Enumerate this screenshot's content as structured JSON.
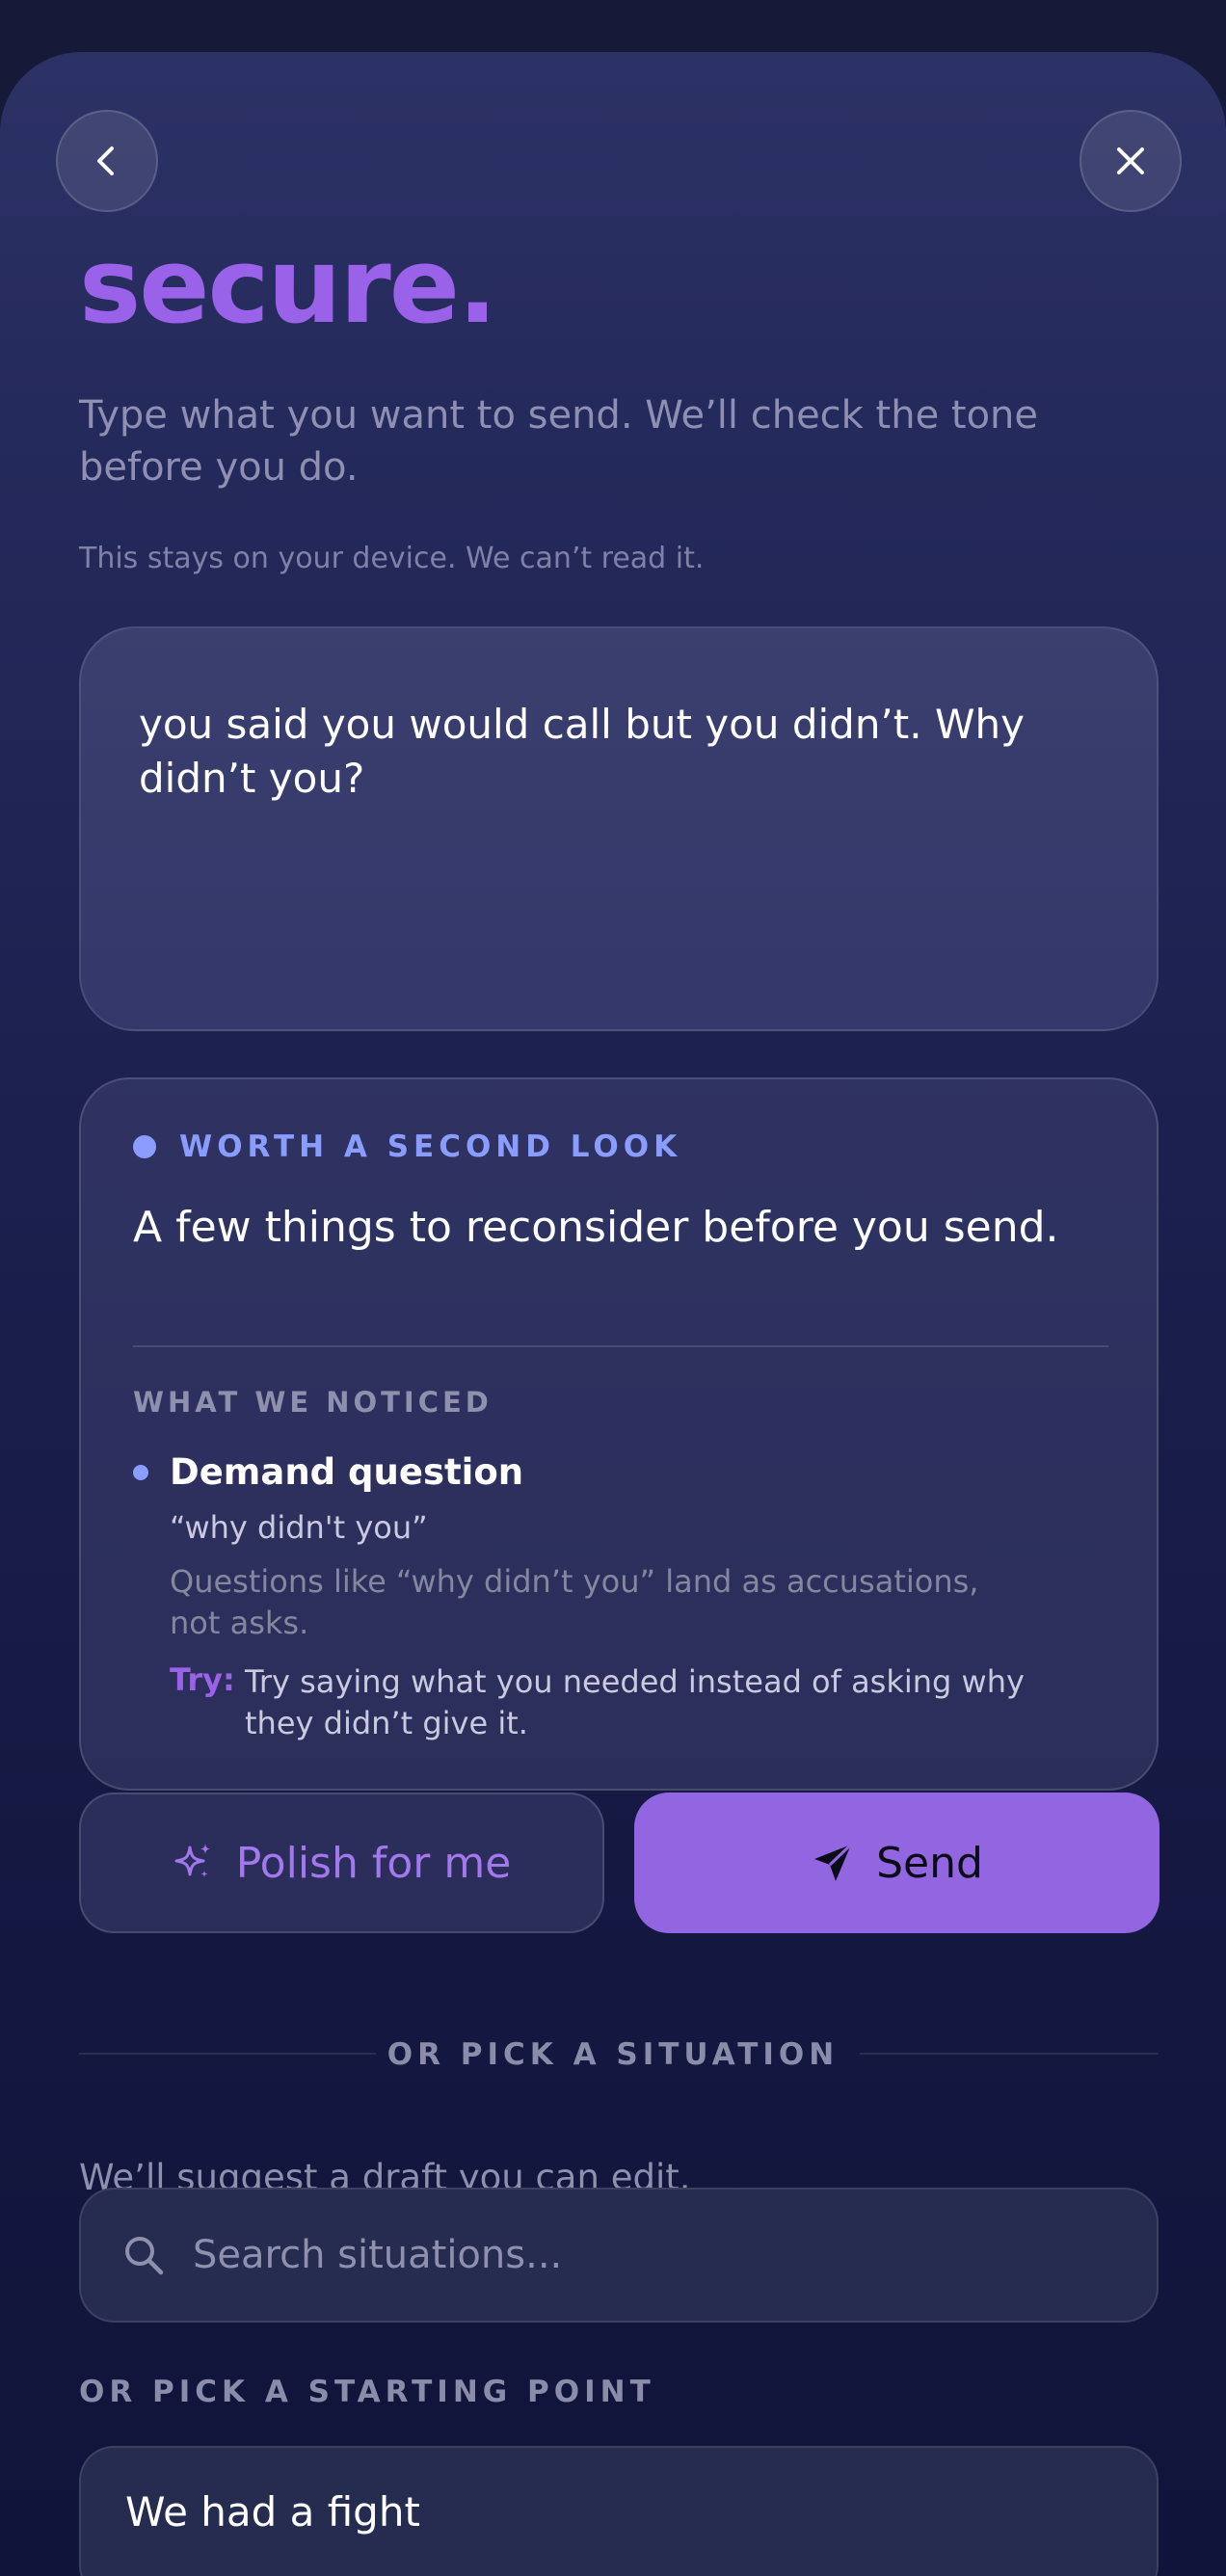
{
  "header": {
    "title": "secure.",
    "subtitle": "Type what you want to send. We’ll check the tone before you do.",
    "privacy_note": "This stays on your device. We can’t read it.",
    "back_icon": "chevron-left-icon",
    "close_icon": "close-icon"
  },
  "message": {
    "text": "you said you would call but you didn’t. Why didn’t you?"
  },
  "analysis": {
    "badge": "WORTH A SECOND LOOK",
    "title": "A few things to reconsider before you send.",
    "section_label": "WHAT WE NOTICED",
    "issues": [
      {
        "title": "Demand question",
        "quote": "“why didn't you”",
        "description": "Questions like “why didn’t you” land as accusations, not asks.",
        "try_label": "Try:",
        "try_text": "Try saying what you needed instead of asking why they didn’t give it."
      }
    ]
  },
  "actions": {
    "polish_label": "Polish for me",
    "polish_icon": "sparkle-icon",
    "send_label": "Send",
    "send_icon": "paper-plane-icon"
  },
  "situations": {
    "divider_label": "OR PICK A SITUATION",
    "helper_text": "We’ll suggest a draft you can edit.",
    "search_placeholder": "Search situations...",
    "search_icon": "search-icon"
  },
  "starting_points": {
    "label": "OR PICK A STARTING POINT",
    "items": [
      "We had a fight"
    ]
  },
  "colors": {
    "accent": "#9a62e8",
    "send_button": "#9166e0",
    "badge": "#8a9dff",
    "background": "#161937"
  }
}
